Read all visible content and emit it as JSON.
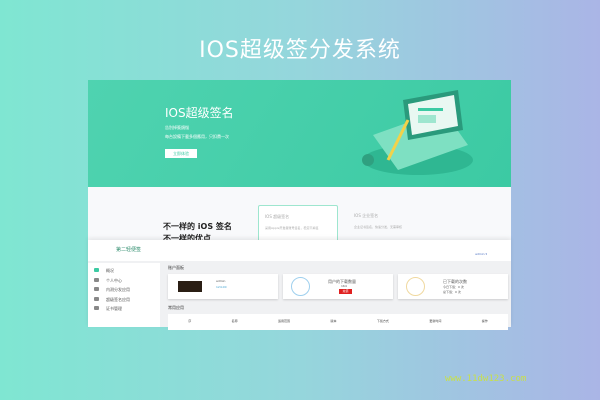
{
  "title": "IOS超级签分发系统",
  "hero": {
    "heading": "IOS超级签名",
    "line1": "告別掉簽煩惱",
    "line2": "每台設備下載多個應用，只扣費一次",
    "button": "立即体验"
  },
  "features": {
    "heading1": "不一样的 iOS 签名",
    "heading2": "不一样的优点",
    "cards": [
      {
        "title": "IOS 超级签名",
        "desc": "采用Apple开发者账号签名，稳定不掉签"
      },
      {
        "title": "IOS 企业签名",
        "desc": "企业证书签名，快速分发，无需审核"
      }
    ]
  },
  "admin": {
    "logo": "第二轻便签",
    "user": "admin ▾",
    "sidebar": [
      "概况",
      "个人中心",
      "内测分发应用",
      "超级签名应用",
      "证书管理"
    ],
    "panel_title": "账户面板",
    "profile": {
      "name": "admin",
      "balance": "124.00"
    },
    "download_card": {
      "label": "用户的下载数量",
      "value": "164",
      "button": "充值"
    },
    "count_card": {
      "label": "已下载的次数",
      "today": "今日下载：0 次",
      "total": "总下载：0 次"
    },
    "apps_title": "常用应用",
    "columns": [
      "序",
      "名称",
      "适用范围",
      "版本",
      "下载方式",
      "更新时间",
      "操作"
    ]
  },
  "watermark": "www.11dw123.com"
}
